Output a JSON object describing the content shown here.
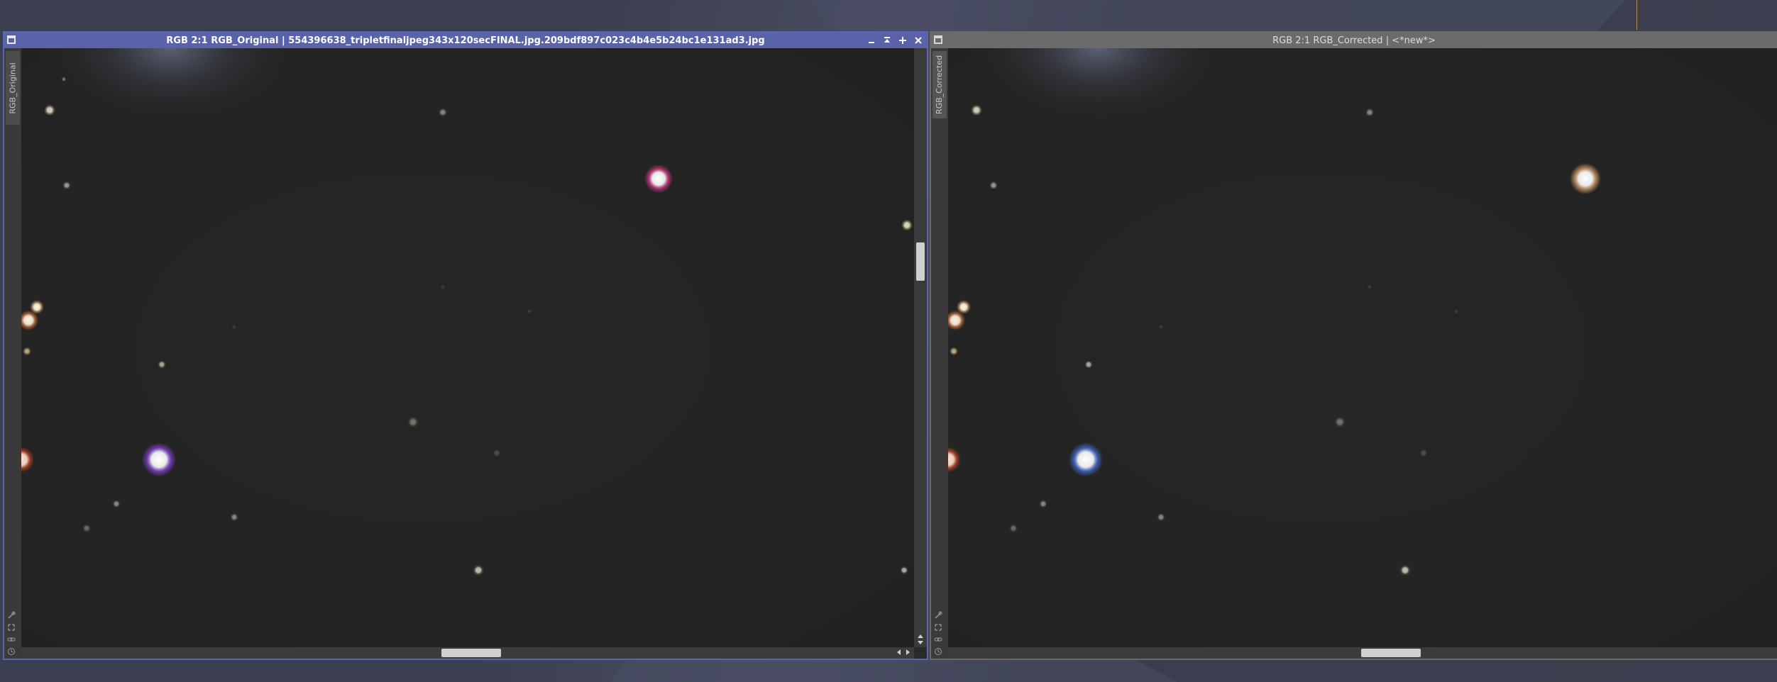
{
  "windows": {
    "original": {
      "title": "RGB 2:1 RGB_Original | 554396638_tripletfinaljpeg343x120secFINAL.jpg.209bdf897c023c4b4e5b24bc1e131ad3.jpg",
      "side_tab": "RGB_Original",
      "active": true
    },
    "corrected": {
      "title": "RGB 2:1 RGB_Corrected | <*new*>",
      "side_tab": "RGB_Corrected",
      "active": false
    }
  },
  "colors": {
    "active_titlebar": "#5a63aa",
    "inactive_titlebar": "#6b6b6b",
    "image_background": "#242424"
  },
  "icons": {
    "title": "window-icon",
    "minimize": "minimize-icon",
    "shade": "shade-icon",
    "maximize": "maximize-icon",
    "close": "close-icon"
  }
}
